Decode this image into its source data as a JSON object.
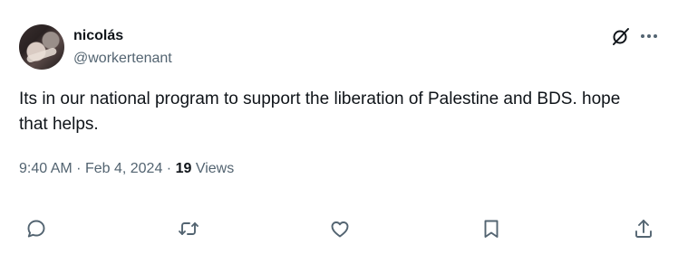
{
  "author": {
    "display_name": "nicolás",
    "handle": "@workertenant"
  },
  "tweet": {
    "text": "Its in our national program to support the liberation of Palestine and BDS. hope that helps.",
    "time": "9:40 AM",
    "date": "Feb 4, 2024",
    "separator": "·",
    "views_count": "19",
    "views_label": "Views"
  },
  "icons": {
    "grok": "grok-icon",
    "more": "more-icon",
    "reply": "reply-icon",
    "retweet": "retweet-icon",
    "like": "like-icon",
    "bookmark": "bookmark-icon",
    "share": "share-icon"
  },
  "colors": {
    "text_primary": "#0f1419",
    "text_secondary": "#536471",
    "icon": "#536471",
    "background": "#ffffff"
  }
}
